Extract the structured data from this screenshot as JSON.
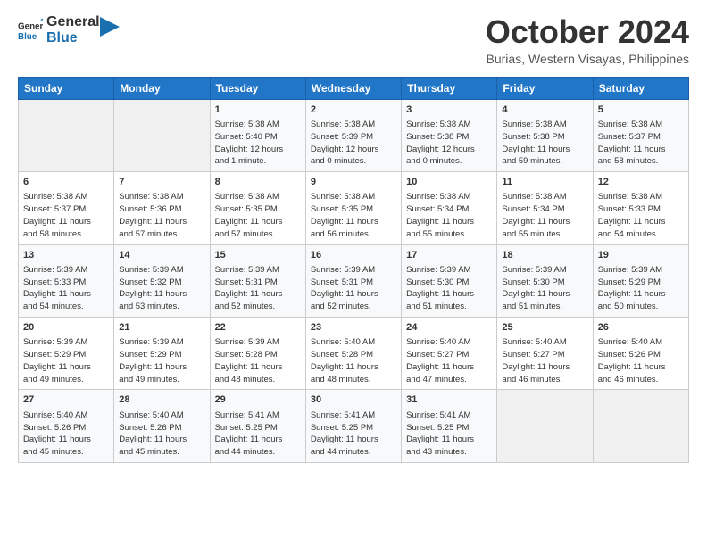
{
  "logo": {
    "general": "General",
    "blue": "Blue"
  },
  "title": "October 2024",
  "subtitle": "Burias, Western Visayas, Philippines",
  "headers": [
    "Sunday",
    "Monday",
    "Tuesday",
    "Wednesday",
    "Thursday",
    "Friday",
    "Saturday"
  ],
  "weeks": [
    [
      {
        "day": "",
        "info": ""
      },
      {
        "day": "",
        "info": ""
      },
      {
        "day": "1",
        "info": "Sunrise: 5:38 AM\nSunset: 5:40 PM\nDaylight: 12 hours\nand 1 minute."
      },
      {
        "day": "2",
        "info": "Sunrise: 5:38 AM\nSunset: 5:39 PM\nDaylight: 12 hours\nand 0 minutes."
      },
      {
        "day": "3",
        "info": "Sunrise: 5:38 AM\nSunset: 5:38 PM\nDaylight: 12 hours\nand 0 minutes."
      },
      {
        "day": "4",
        "info": "Sunrise: 5:38 AM\nSunset: 5:38 PM\nDaylight: 11 hours\nand 59 minutes."
      },
      {
        "day": "5",
        "info": "Sunrise: 5:38 AM\nSunset: 5:37 PM\nDaylight: 11 hours\nand 58 minutes."
      }
    ],
    [
      {
        "day": "6",
        "info": "Sunrise: 5:38 AM\nSunset: 5:37 PM\nDaylight: 11 hours\nand 58 minutes."
      },
      {
        "day": "7",
        "info": "Sunrise: 5:38 AM\nSunset: 5:36 PM\nDaylight: 11 hours\nand 57 minutes."
      },
      {
        "day": "8",
        "info": "Sunrise: 5:38 AM\nSunset: 5:35 PM\nDaylight: 11 hours\nand 57 minutes."
      },
      {
        "day": "9",
        "info": "Sunrise: 5:38 AM\nSunset: 5:35 PM\nDaylight: 11 hours\nand 56 minutes."
      },
      {
        "day": "10",
        "info": "Sunrise: 5:38 AM\nSunset: 5:34 PM\nDaylight: 11 hours\nand 55 minutes."
      },
      {
        "day": "11",
        "info": "Sunrise: 5:38 AM\nSunset: 5:34 PM\nDaylight: 11 hours\nand 55 minutes."
      },
      {
        "day": "12",
        "info": "Sunrise: 5:38 AM\nSunset: 5:33 PM\nDaylight: 11 hours\nand 54 minutes."
      }
    ],
    [
      {
        "day": "13",
        "info": "Sunrise: 5:39 AM\nSunset: 5:33 PM\nDaylight: 11 hours\nand 54 minutes."
      },
      {
        "day": "14",
        "info": "Sunrise: 5:39 AM\nSunset: 5:32 PM\nDaylight: 11 hours\nand 53 minutes."
      },
      {
        "day": "15",
        "info": "Sunrise: 5:39 AM\nSunset: 5:31 PM\nDaylight: 11 hours\nand 52 minutes."
      },
      {
        "day": "16",
        "info": "Sunrise: 5:39 AM\nSunset: 5:31 PM\nDaylight: 11 hours\nand 52 minutes."
      },
      {
        "day": "17",
        "info": "Sunrise: 5:39 AM\nSunset: 5:30 PM\nDaylight: 11 hours\nand 51 minutes."
      },
      {
        "day": "18",
        "info": "Sunrise: 5:39 AM\nSunset: 5:30 PM\nDaylight: 11 hours\nand 51 minutes."
      },
      {
        "day": "19",
        "info": "Sunrise: 5:39 AM\nSunset: 5:29 PM\nDaylight: 11 hours\nand 50 minutes."
      }
    ],
    [
      {
        "day": "20",
        "info": "Sunrise: 5:39 AM\nSunset: 5:29 PM\nDaylight: 11 hours\nand 49 minutes."
      },
      {
        "day": "21",
        "info": "Sunrise: 5:39 AM\nSunset: 5:29 PM\nDaylight: 11 hours\nand 49 minutes."
      },
      {
        "day": "22",
        "info": "Sunrise: 5:39 AM\nSunset: 5:28 PM\nDaylight: 11 hours\nand 48 minutes."
      },
      {
        "day": "23",
        "info": "Sunrise: 5:40 AM\nSunset: 5:28 PM\nDaylight: 11 hours\nand 48 minutes."
      },
      {
        "day": "24",
        "info": "Sunrise: 5:40 AM\nSunset: 5:27 PM\nDaylight: 11 hours\nand 47 minutes."
      },
      {
        "day": "25",
        "info": "Sunrise: 5:40 AM\nSunset: 5:27 PM\nDaylight: 11 hours\nand 46 minutes."
      },
      {
        "day": "26",
        "info": "Sunrise: 5:40 AM\nSunset: 5:26 PM\nDaylight: 11 hours\nand 46 minutes."
      }
    ],
    [
      {
        "day": "27",
        "info": "Sunrise: 5:40 AM\nSunset: 5:26 PM\nDaylight: 11 hours\nand 45 minutes."
      },
      {
        "day": "28",
        "info": "Sunrise: 5:40 AM\nSunset: 5:26 PM\nDaylight: 11 hours\nand 45 minutes."
      },
      {
        "day": "29",
        "info": "Sunrise: 5:41 AM\nSunset: 5:25 PM\nDaylight: 11 hours\nand 44 minutes."
      },
      {
        "day": "30",
        "info": "Sunrise: 5:41 AM\nSunset: 5:25 PM\nDaylight: 11 hours\nand 44 minutes."
      },
      {
        "day": "31",
        "info": "Sunrise: 5:41 AM\nSunset: 5:25 PM\nDaylight: 11 hours\nand 43 minutes."
      },
      {
        "day": "",
        "info": ""
      },
      {
        "day": "",
        "info": ""
      }
    ]
  ]
}
